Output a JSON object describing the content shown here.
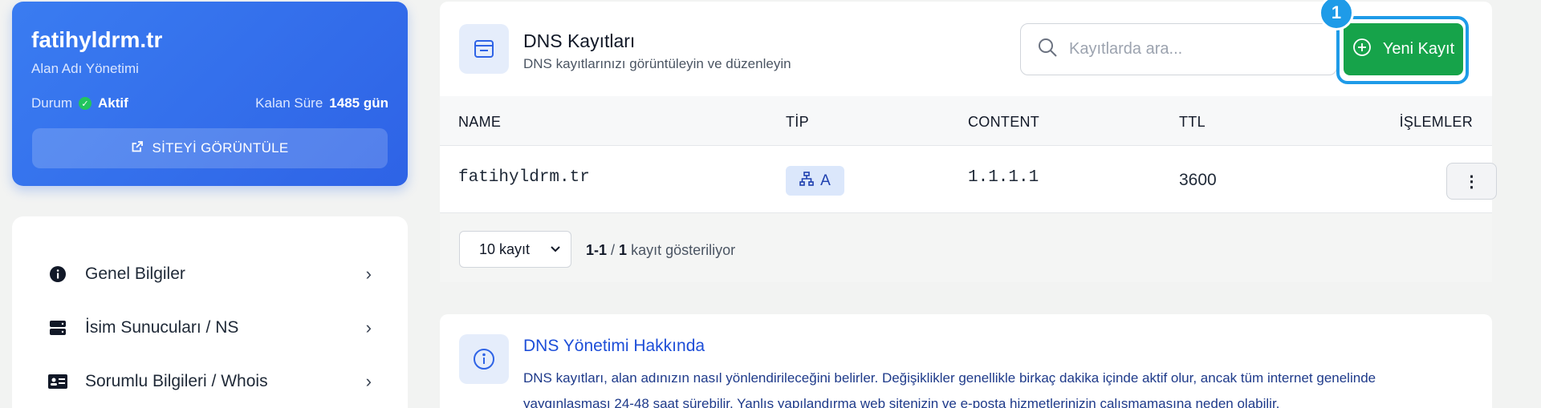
{
  "domain_card": {
    "name": "fatihyldrm.tr",
    "subtitle": "Alan Adı Yönetimi",
    "status_label": "Durum",
    "status_value": "Aktif",
    "remaining_label": "Kalan Süre",
    "remaining_value": "1485 gün",
    "view_site_label": "SİTEYİ GÖRÜNTÜLE"
  },
  "side_menu": {
    "items": [
      {
        "label": "Genel Bilgiler",
        "icon": "info-circle-icon"
      },
      {
        "label": "İsim Sunucuları / NS",
        "icon": "server-icon"
      },
      {
        "label": "Sorumlu Bilgileri / Whois",
        "icon": "id-card-icon"
      }
    ]
  },
  "dns": {
    "title": "DNS Kayıtları",
    "subtitle": "DNS kayıtlarınızı görüntüleyin ve düzenleyin",
    "search_placeholder": "Kayıtlarda ara...",
    "new_record_label": "Yeni Kayıt",
    "step_badge": "1",
    "columns": [
      "NAME",
      "TİP",
      "CONTENT",
      "TTL",
      "İŞLEMLER"
    ],
    "rows": [
      {
        "name": "fatihyldrm.tr",
        "type": "A",
        "content": "1.1.1.1",
        "ttl": "3600"
      }
    ],
    "per_page": "10 kayıt",
    "showing_range": "1-1",
    "showing_total": "1",
    "showing_suffix": "kayıt gösteriliyor"
  },
  "info": {
    "title": "DNS Yönetimi Hakkında",
    "text": "DNS kayıtları, alan adınızın nasıl yönlendirileceğini belirler. Değişiklikler genellikle birkaç dakika içinde aktif olur, ancak tüm internet genelinde yaygınlaşması 24-48 saat sürebilir. Yanlış yapılandırma web sitenizin ve e-posta hizmetlerinizin çalışmamasına neden olabilir."
  },
  "colors": {
    "primary": "#2e63e6",
    "success": "#16a34a",
    "highlight": "#1e9be8",
    "info_text": "#1e3a8a"
  }
}
